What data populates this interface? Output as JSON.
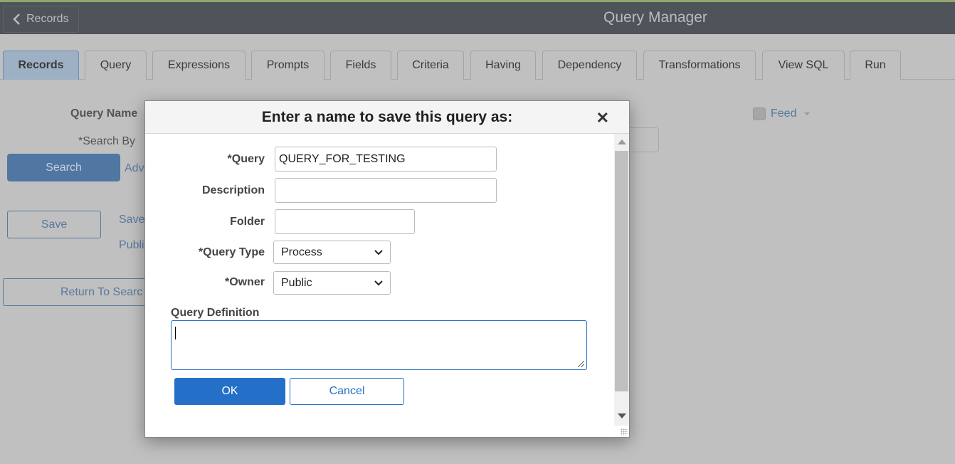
{
  "header": {
    "back_label": "Records",
    "title": "Query Manager"
  },
  "tabs": [
    {
      "label": "Records",
      "active": true
    },
    {
      "label": "Query"
    },
    {
      "label": "Expressions"
    },
    {
      "label": "Prompts"
    },
    {
      "label": "Fields"
    },
    {
      "label": "Criteria"
    },
    {
      "label": "Having"
    },
    {
      "label": "Dependency"
    },
    {
      "label": "Transformations"
    },
    {
      "label": "View SQL"
    },
    {
      "label": "Run"
    }
  ],
  "background": {
    "query_name_label": "Query Name",
    "search_by_label": "*Search By",
    "search_button": "Search",
    "advanced_link": "Adv",
    "save_button": "Save",
    "save_as_link": "Save",
    "public_link": "Publi",
    "return_button": "Return To Searc",
    "feed_label": "Feed"
  },
  "dialog": {
    "title": "Enter a name to save this query as:",
    "close_icon": "close-icon",
    "query_label": "*Query",
    "query_value": "QUERY_FOR_TESTING",
    "description_label": "Description",
    "description_value": "",
    "folder_label": "Folder",
    "folder_value": "",
    "query_type_label": "*Query Type",
    "query_type_value": "Process",
    "owner_label": "*Owner",
    "owner_value": "Public",
    "definition_label": "Query Definition",
    "definition_value": "",
    "ok_button": "OK",
    "cancel_button": "Cancel"
  },
  "colors": {
    "primary": "#2470c8",
    "header": "#4f545b",
    "overlay_bg": "#c0c0c0"
  }
}
